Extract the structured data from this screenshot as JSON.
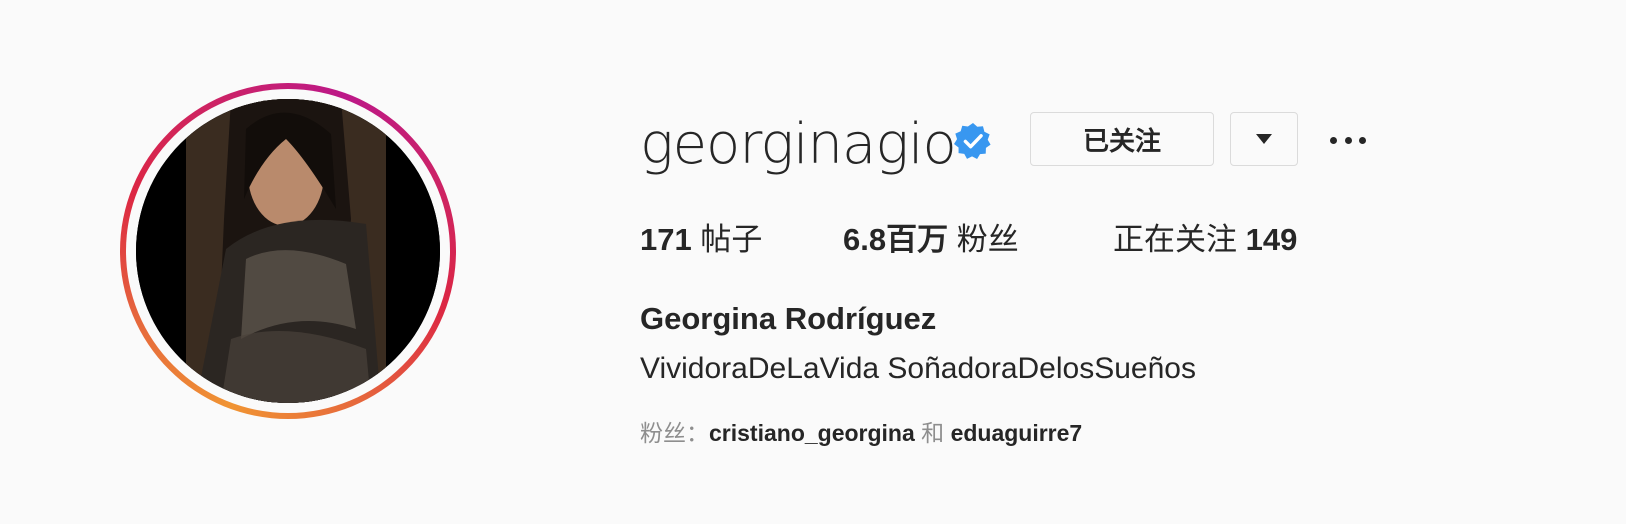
{
  "profile": {
    "username": "georginagio",
    "verified": true,
    "full_name": "Georgina Rodríguez",
    "bio": "VividoraDeLaVida SoñadoraDelosSueños"
  },
  "actions": {
    "following_label": "已关注"
  },
  "stats": {
    "posts_count": "171",
    "posts_label": "帖子",
    "followers_count": "6.8百万",
    "followers_label": "粉丝",
    "following_label": "正在关注",
    "following_count": "149"
  },
  "followed_by": {
    "prefix": "粉丝：",
    "user1": "cristiano_georgina",
    "connector": "和",
    "user2": "eduaguirre7"
  },
  "colors": {
    "verified_badge": "#3897f0",
    "text": "#262626",
    "muted": "#8e8e8e"
  }
}
